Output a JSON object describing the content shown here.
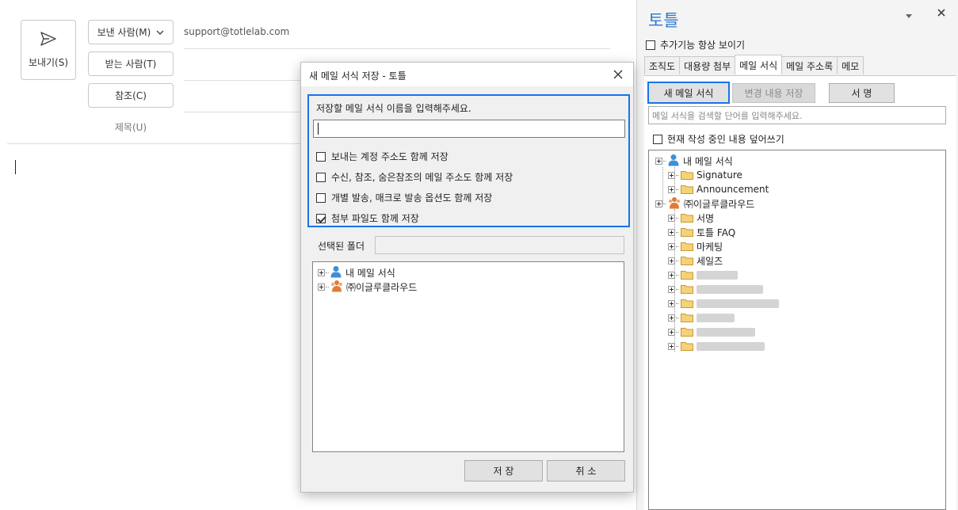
{
  "compose": {
    "send_label": "보내기(S)",
    "from_button": "보낸 사람(M)",
    "to_button": "받는 사람(T)",
    "cc_button": "참조(C)",
    "subject_label": "제목(U)",
    "from_address": "support@totlelab.com"
  },
  "pane": {
    "title": "토틀",
    "always_show_label": "추가기능 항상 보이기",
    "always_show_checked": false,
    "tabs": [
      {
        "label": "조직도",
        "active": false
      },
      {
        "label": "대용량 첨부",
        "active": false
      },
      {
        "label": "메일 서식",
        "active": true
      },
      {
        "label": "메일 주소록",
        "active": false
      },
      {
        "label": "메모",
        "active": false
      }
    ],
    "new_template_button": "새 메일 서식",
    "save_changes_button": "변경 내용 저장",
    "signature_button": "서 명",
    "search_placeholder": "메일 서식을 검색할 단어를 입력해주세요.",
    "overwrite_label": "현재 작성 중인 내용 덮어쓰기",
    "overwrite_checked": false,
    "tree": {
      "my_templates": "내 메일 서식",
      "my_children": [
        "Signature",
        "Announcement"
      ],
      "company": "㈜이글루클라우드",
      "company_children": [
        "서명",
        "토틀 FAQ",
        "마케팅",
        "세일즈"
      ],
      "redacted_count": 6
    }
  },
  "dialog": {
    "title": "새 메일 서식 저장 - 토틀",
    "prompt": "저장할 메일 서식 이름을 입력해주세요.",
    "name_value": "",
    "options": [
      {
        "label": "보내는 계정 주소도 함께 저장",
        "checked": false
      },
      {
        "label": "수신, 참조, 숨은참조의 메일 주소도 함께 저장",
        "checked": false
      },
      {
        "label": "개별 발송, 매크로 발송 옵션도 함께 저장",
        "checked": false
      },
      {
        "label": "첨부 파일도 함께 저장",
        "checked": true
      }
    ],
    "folder_label": "선택된 폴더",
    "folder_value": "",
    "tree": {
      "my_templates": "내 메일 서식",
      "company": "㈜이글루클라우드"
    },
    "save_button": "저 장",
    "cancel_button": "취 소"
  },
  "colors": {
    "accent": "#1a73e8",
    "title_blue": "#2e78c7",
    "folder": "#f5d27a",
    "person_blue": "#3d8fd6",
    "person_orange": "#e07b39"
  }
}
